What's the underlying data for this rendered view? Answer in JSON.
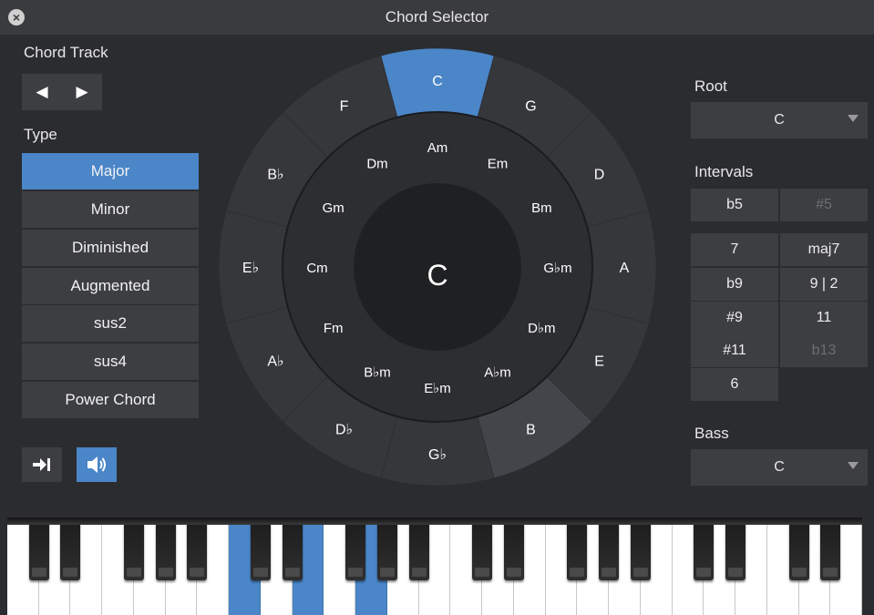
{
  "window": {
    "title": "Chord Selector",
    "close_icon": "close-icon"
  },
  "left": {
    "chord_track_label": "Chord Track",
    "prev_icon": "◀",
    "next_icon": "▶",
    "type_label": "Type",
    "types": [
      {
        "label": "Major",
        "selected": true
      },
      {
        "label": "Minor",
        "selected": false
      },
      {
        "label": "Diminished",
        "selected": false
      },
      {
        "label": "Augmented",
        "selected": false
      },
      {
        "label": "sus2",
        "selected": false
      },
      {
        "label": "sus4",
        "selected": false
      },
      {
        "label": "Power Chord",
        "selected": false
      }
    ],
    "transfer_icon": "arrow-to-bar-icon",
    "speaker_icon": "speaker-icon",
    "speaker_active": true
  },
  "wheel": {
    "center": "C",
    "selected": "C",
    "highlighted": "B",
    "outer": [
      "C",
      "G",
      "D",
      "A",
      "E",
      "B",
      "G♭",
      "D♭",
      "A♭",
      "E♭",
      "B♭",
      "F"
    ],
    "inner": [
      "Am",
      "Em",
      "Bm",
      "G♭m",
      "D♭m",
      "A♭m",
      "E♭m",
      "B♭m",
      "Fm",
      "Cm",
      "Gm",
      "Dm"
    ],
    "colors": {
      "selected": "#4a86c8",
      "highlighted": "#43454a",
      "outer_ring": "#36373a",
      "inner_ring": "#2d2e31",
      "center": "#1f2022"
    }
  },
  "right": {
    "root_label": "Root",
    "root_value": "C",
    "intervals_label": "Intervals",
    "intervals": [
      {
        "label": "b5",
        "enabled": true
      },
      {
        "label": "#5",
        "enabled": false
      },
      {
        "label": "7",
        "enabled": true
      },
      {
        "label": "maj7",
        "enabled": true
      },
      {
        "label": "b9",
        "enabled": true
      },
      {
        "label": "9 | 2",
        "enabled": true
      },
      {
        "label": "#9",
        "enabled": true
      },
      {
        "label": "11",
        "enabled": true
      },
      {
        "label": "#11",
        "enabled": true
      },
      {
        "label": "b13",
        "enabled": false
      },
      {
        "label": "6",
        "enabled": true
      }
    ],
    "bass_label": "Bass",
    "bass_value": "C"
  },
  "keyboard": {
    "white_key_count": 27,
    "highlighted_white_keys": [
      7,
      9,
      11
    ],
    "accent": "#4a86c8"
  }
}
